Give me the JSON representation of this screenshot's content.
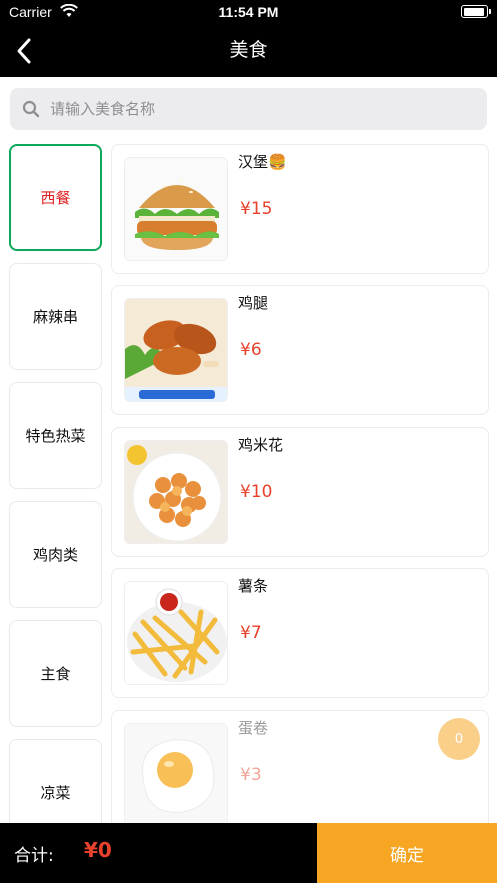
{
  "status_bar": {
    "carrier": "Carrier",
    "time": "11:54 PM"
  },
  "nav": {
    "title": "美食"
  },
  "search": {
    "placeholder": "请输入美食名称"
  },
  "categories": [
    {
      "label": "西餐",
      "selected": true
    },
    {
      "label": "麻辣串"
    },
    {
      "label": "特色热菜"
    },
    {
      "label": "鸡肉类"
    },
    {
      "label": "主食"
    },
    {
      "label": "凉菜"
    }
  ],
  "products": [
    {
      "name": "汉堡🍔",
      "price": "¥15",
      "image": "burger-image"
    },
    {
      "name": "鸡腿",
      "price": "¥6",
      "image": "chicken-leg-image"
    },
    {
      "name": "鸡米花",
      "price": "¥10",
      "image": "popcorn-chicken-image"
    },
    {
      "name": "薯条",
      "price": "¥7",
      "image": "fries-image"
    },
    {
      "name": "蛋卷",
      "price": "¥3",
      "image": "egg-image"
    }
  ],
  "cart_badge": {
    "count": "0"
  },
  "footer": {
    "total_label": "合计:",
    "total_value": "¥0",
    "confirm_label": "确定"
  },
  "colors": {
    "accent": "#f6a623",
    "price": "#e8412c",
    "selected_border": "#0ea85a"
  }
}
